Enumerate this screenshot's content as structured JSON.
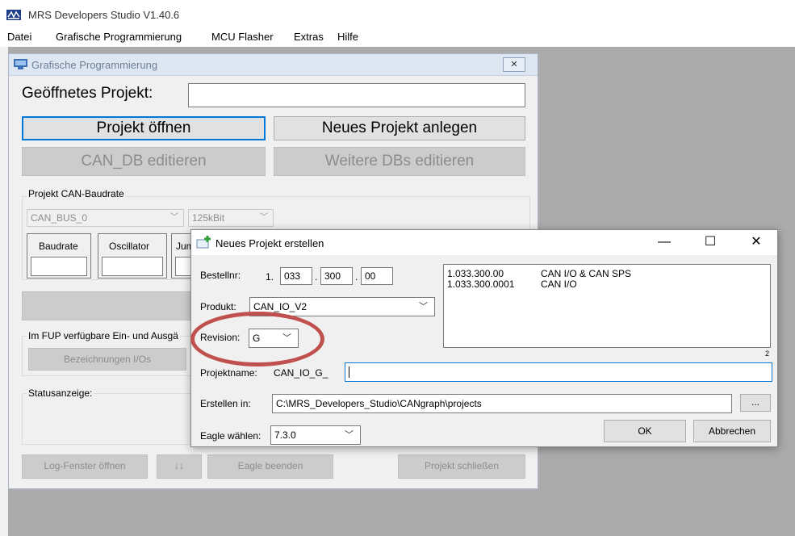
{
  "app": {
    "title": "MRS Developers Studio V1.40.6",
    "menu": [
      "Datei",
      "Grafische Programmierung",
      "MCU Flasher",
      "Extras",
      "Hilfe"
    ]
  },
  "inner": {
    "title": "Grafische Programmierung",
    "close_label": "✕",
    "opened_project_label": "Geöffnetes Projekt:",
    "opened_project_value": "",
    "btn_open": "Projekt öffnen",
    "btn_new": "Neues Projekt anlegen",
    "btn_can_db": "CAN_DB editieren",
    "btn_more_dbs": "Weitere DBs editieren",
    "baud_group": "Projekt CAN-Baudrate",
    "bus_combo": "CAN_BUS_0",
    "rate_combo": "125kBit",
    "box_baudrate": "Baudrate",
    "box_oscillator": "Oscillator",
    "box_jump": "Jum",
    "io_group": "Im FUP verfügbare Ein- und Ausgä",
    "btn_io_names": "Bezeichnungen I/Os",
    "status_group": "Statusanzeige:",
    "btn_log": "Log-Fenster öffnen",
    "btn_arrows": "↓↓",
    "btn_eagle_quit": "Eagle beenden",
    "btn_close_project": "Projekt schließen"
  },
  "dialog": {
    "title": "Neues Projekt erstellen",
    "title_icon_glyph": "+",
    "minimize": "—",
    "maximize": "☐",
    "close": "✕",
    "order_label": "Bestellnr:",
    "order_prefix": "1.",
    "order_p1": "033",
    "order_p2": "300",
    "order_p3": "00",
    "dot": ".",
    "product_label": "Produkt:",
    "product_value": "CAN_IO_V2",
    "revision_label": "Revision:",
    "revision_value": "G",
    "list": [
      {
        "code": "1.033.300.00",
        "desc": "CAN I/O & CAN SPS"
      },
      {
        "code": "1.033.300.0001",
        "desc": "CAN I/O"
      }
    ],
    "list_count": "2",
    "project_name_label": "Projektname:",
    "project_name_prefix": "CAN_IO_G_",
    "project_name_value": "",
    "create_in_label": "Erstellen in:",
    "create_in_value": "C:\\MRS_Developers_Studio\\CANgraph\\projects",
    "browse_label": "...",
    "eagle_label": "Eagle wählen:",
    "eagle_value": "7.3.0",
    "ok_label": "OK",
    "cancel_label": "Abbrechen"
  }
}
